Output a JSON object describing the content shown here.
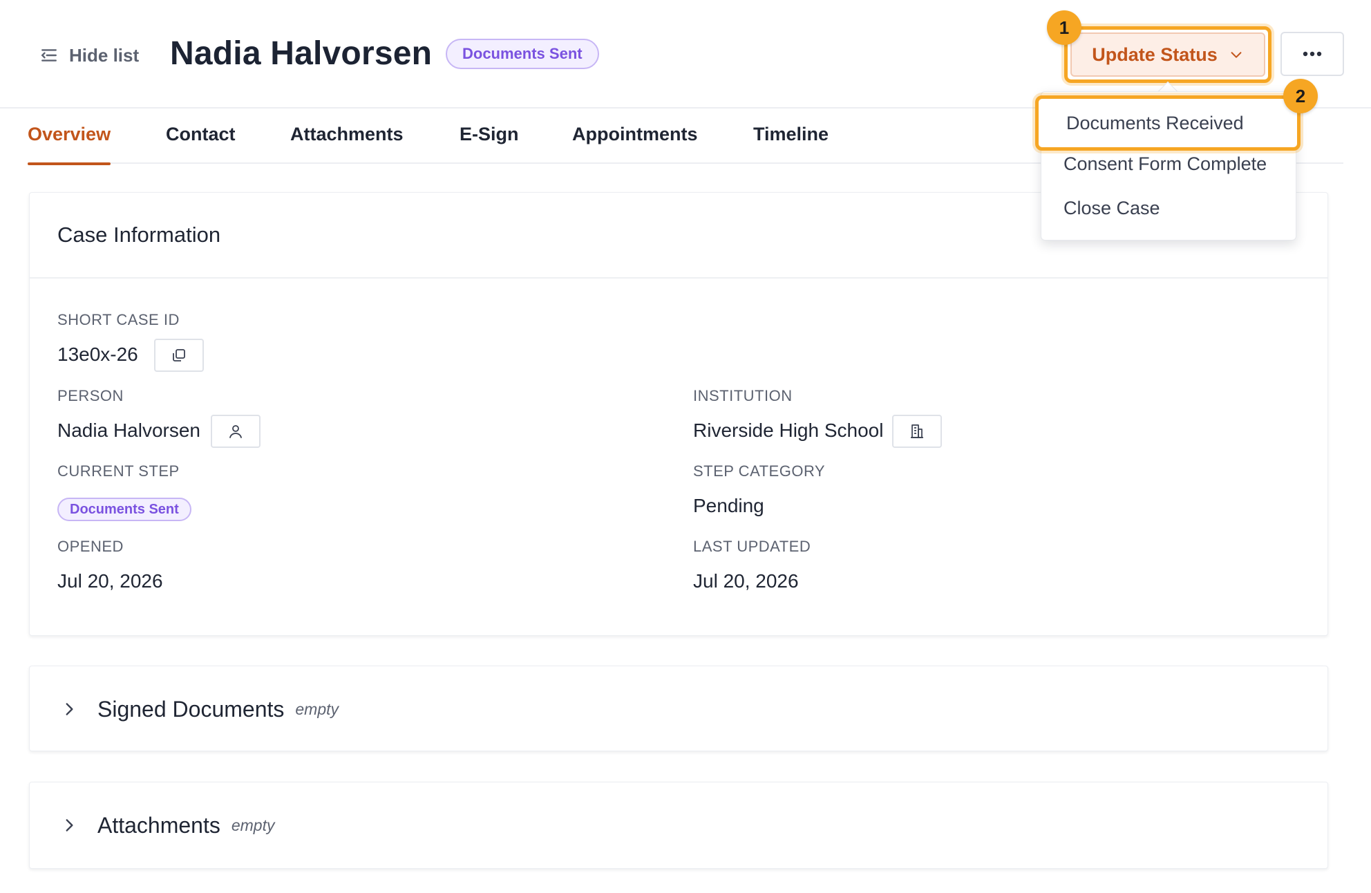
{
  "header": {
    "hide_list_label": "Hide list",
    "title": "Nadia Halvorsen",
    "status_badge": "Documents Sent",
    "update_status_label": "Update Status",
    "more_icon": "ellipsis-icon"
  },
  "markers": [
    "1",
    "2"
  ],
  "tabs": [
    {
      "label": "Overview",
      "active": true
    },
    {
      "label": "Contact",
      "active": false
    },
    {
      "label": "Attachments",
      "active": false
    },
    {
      "label": "E-Sign",
      "active": false
    },
    {
      "label": "Appointments",
      "active": false
    },
    {
      "label": "Timeline",
      "active": false
    }
  ],
  "dropdown": {
    "items": [
      "Documents Received",
      "Consent Form Complete",
      "Close Case"
    ],
    "highlighted": "Documents Received"
  },
  "case_info": {
    "title": "Case Information",
    "short_case_id_label": "SHORT CASE ID",
    "short_case_id": "13e0x-26",
    "person_label": "PERSON",
    "person": "Nadia Halvorsen",
    "institution_label": "INSTITUTION",
    "institution": "Riverside High School",
    "current_step_label": "CURRENT STEP",
    "current_step": "Documents Sent",
    "step_category_label": "STEP CATEGORY",
    "step_category": "Pending",
    "opened_label": "OPENED",
    "opened": "Jul 20, 2026",
    "last_updated_label": "LAST UPDATED",
    "last_updated": "Jul 20, 2026"
  },
  "sections": [
    {
      "title": "Signed Documents",
      "state": "empty"
    },
    {
      "title": "Attachments",
      "state": "empty"
    }
  ],
  "colors": {
    "accent": "#c2551b",
    "highlight": "#f6a623",
    "badge_text": "#7a52e0",
    "badge_bg": "#f3efff"
  }
}
